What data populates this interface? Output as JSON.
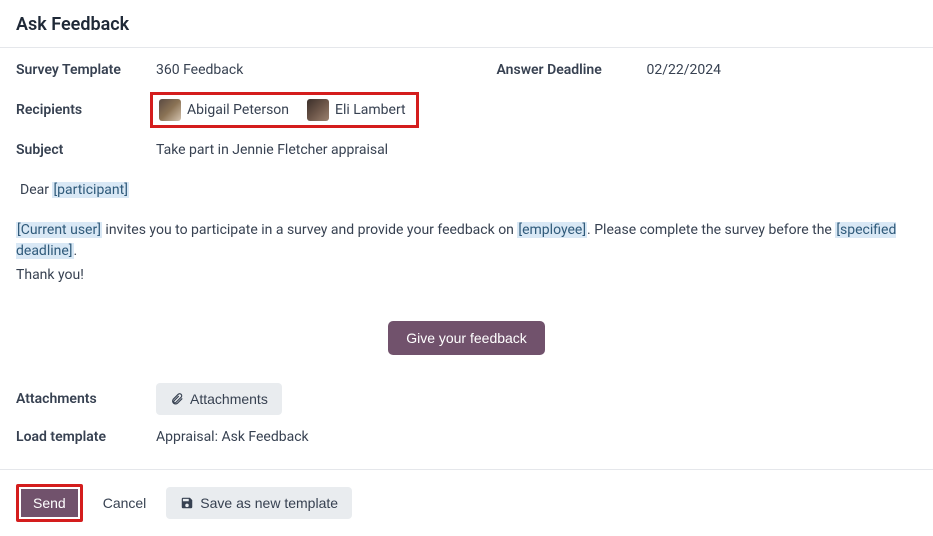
{
  "header": {
    "title": "Ask Feedback"
  },
  "fields": {
    "survey_template_label": "Survey Template",
    "survey_template_value": "360 Feedback",
    "answer_deadline_label": "Answer Deadline",
    "answer_deadline_value": "02/22/2024",
    "recipients_label": "Recipients",
    "recipients": [
      {
        "name": "Abigail Peterson"
      },
      {
        "name": "Eli Lambert"
      }
    ],
    "subject_label": "Subject",
    "subject_value": "Take part in Jennie Fletcher appraisal",
    "attachments_label": "Attachments",
    "attachments_button": "Attachments",
    "load_template_label": "Load template",
    "load_template_value": "Appraisal: Ask Feedback"
  },
  "message": {
    "greeting_prefix": "Dear ",
    "greeting_placeholder": "[participant]",
    "body_a": "[Current user]",
    "body_b": " invites you to participate in a survey and provide your feedback on ",
    "body_c": "[employee]",
    "body_d": ". Please complete the survey before the ",
    "body_e": "[specified deadline]",
    "body_f": ".",
    "thanks": "Thank you!",
    "cta": "Give your feedback"
  },
  "footer": {
    "send": "Send",
    "cancel": "Cancel",
    "save_template": "Save as new template"
  }
}
